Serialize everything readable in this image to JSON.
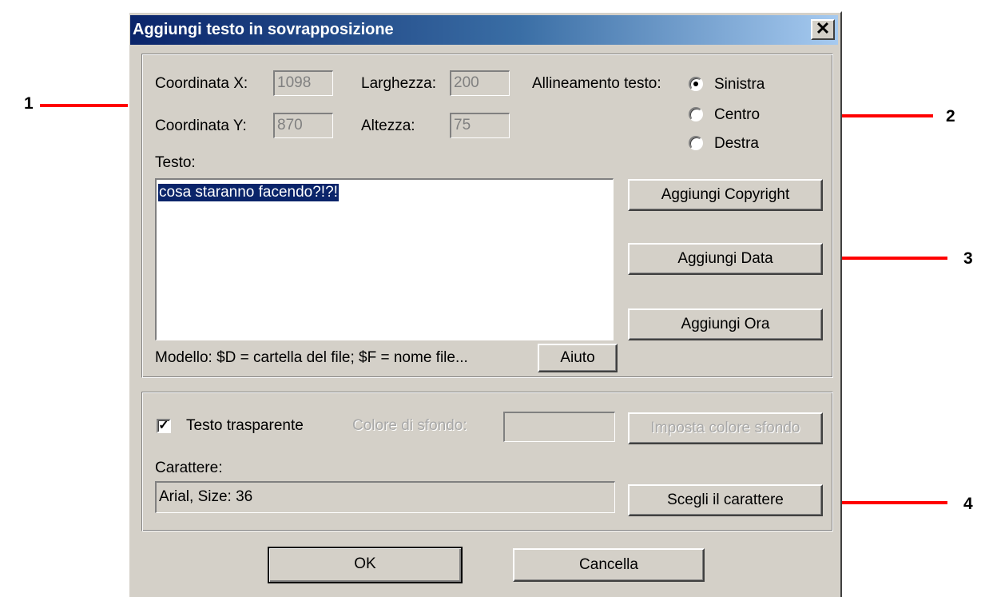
{
  "window": {
    "title": "Aggiungi testo in sovrapposizione",
    "close_glyph": "✕"
  },
  "position": {
    "x_label": "Coordinata X:",
    "x_value": "1098",
    "y_label": "Coordinata Y:",
    "y_value": "870",
    "width_label": "Larghezza:",
    "width_value": "200",
    "height_label": "Altezza:",
    "height_value": "75"
  },
  "alignment": {
    "label": "Allineamento testo:",
    "options": [
      "Sinistra",
      "Centro",
      "Destra"
    ],
    "selected": "Sinistra"
  },
  "text_section": {
    "label": "Testo:",
    "value": "cosa staranno facendo?!?!",
    "template_hint": "Modello: $D = cartella del file; $F = nome file...",
    "help_button": "Aiuto"
  },
  "insert_buttons": {
    "copyright": "Aggiungi Copyright",
    "date": "Aggiungi Data",
    "time": "Aggiungi Ora"
  },
  "appearance": {
    "transparent_label": "Testo trasparente",
    "transparent_checked": true,
    "bg_color_label": "Colore di sfondo:",
    "set_bg_button": "Imposta colore sfondo",
    "font_label": "Carattere:",
    "font_value": "Arial, Size: 36",
    "choose_font_button": "Scegli il carattere"
  },
  "footer": {
    "ok": "OK",
    "cancel": "Cancella"
  },
  "annotations": {
    "marker_1": "1",
    "marker_2": "2",
    "marker_3": "3",
    "marker_4": "4"
  },
  "colors": {
    "arrow": "#ff0000",
    "title_start": "#0a246a",
    "title_end": "#a6caf0",
    "dialog_bg": "#d4d0c8",
    "selection": "#0a246a"
  },
  "icons": {
    "close": "close-icon",
    "arrow": "red-arrow-icon"
  }
}
